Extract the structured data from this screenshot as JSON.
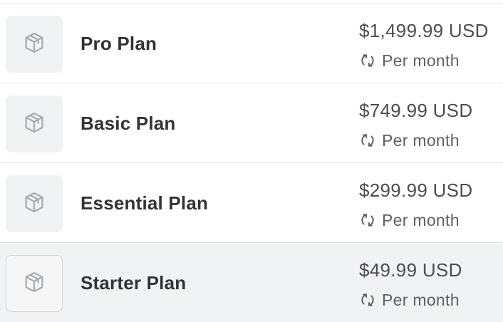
{
  "plans": [
    {
      "name": "Pro Plan",
      "price": "$1,499.99 USD",
      "interval": "Per month",
      "thumbnail_icon": "package-icon",
      "interval_icon": "recurring-icon"
    },
    {
      "name": "Basic Plan",
      "price": "$749.99 USD",
      "interval": "Per month",
      "thumbnail_icon": "package-icon",
      "interval_icon": "recurring-icon"
    },
    {
      "name": "Essential Plan",
      "price": "$299.99 USD",
      "interval": "Per month",
      "thumbnail_icon": "package-icon",
      "interval_icon": "recurring-icon"
    },
    {
      "name": "Starter Plan",
      "price": "$49.99 USD",
      "interval": "Per month",
      "thumbnail_icon": "package-icon",
      "interval_icon": "recurring-icon",
      "selected": true
    }
  ],
  "colors": {
    "text_primary": "#303338",
    "text_secondary": "#5d6168",
    "divider": "#e3e5e8",
    "thumb_bg": "#f1f2f4",
    "selected_row_bg": "#f1f2f4",
    "icon": "#a8acb3"
  }
}
